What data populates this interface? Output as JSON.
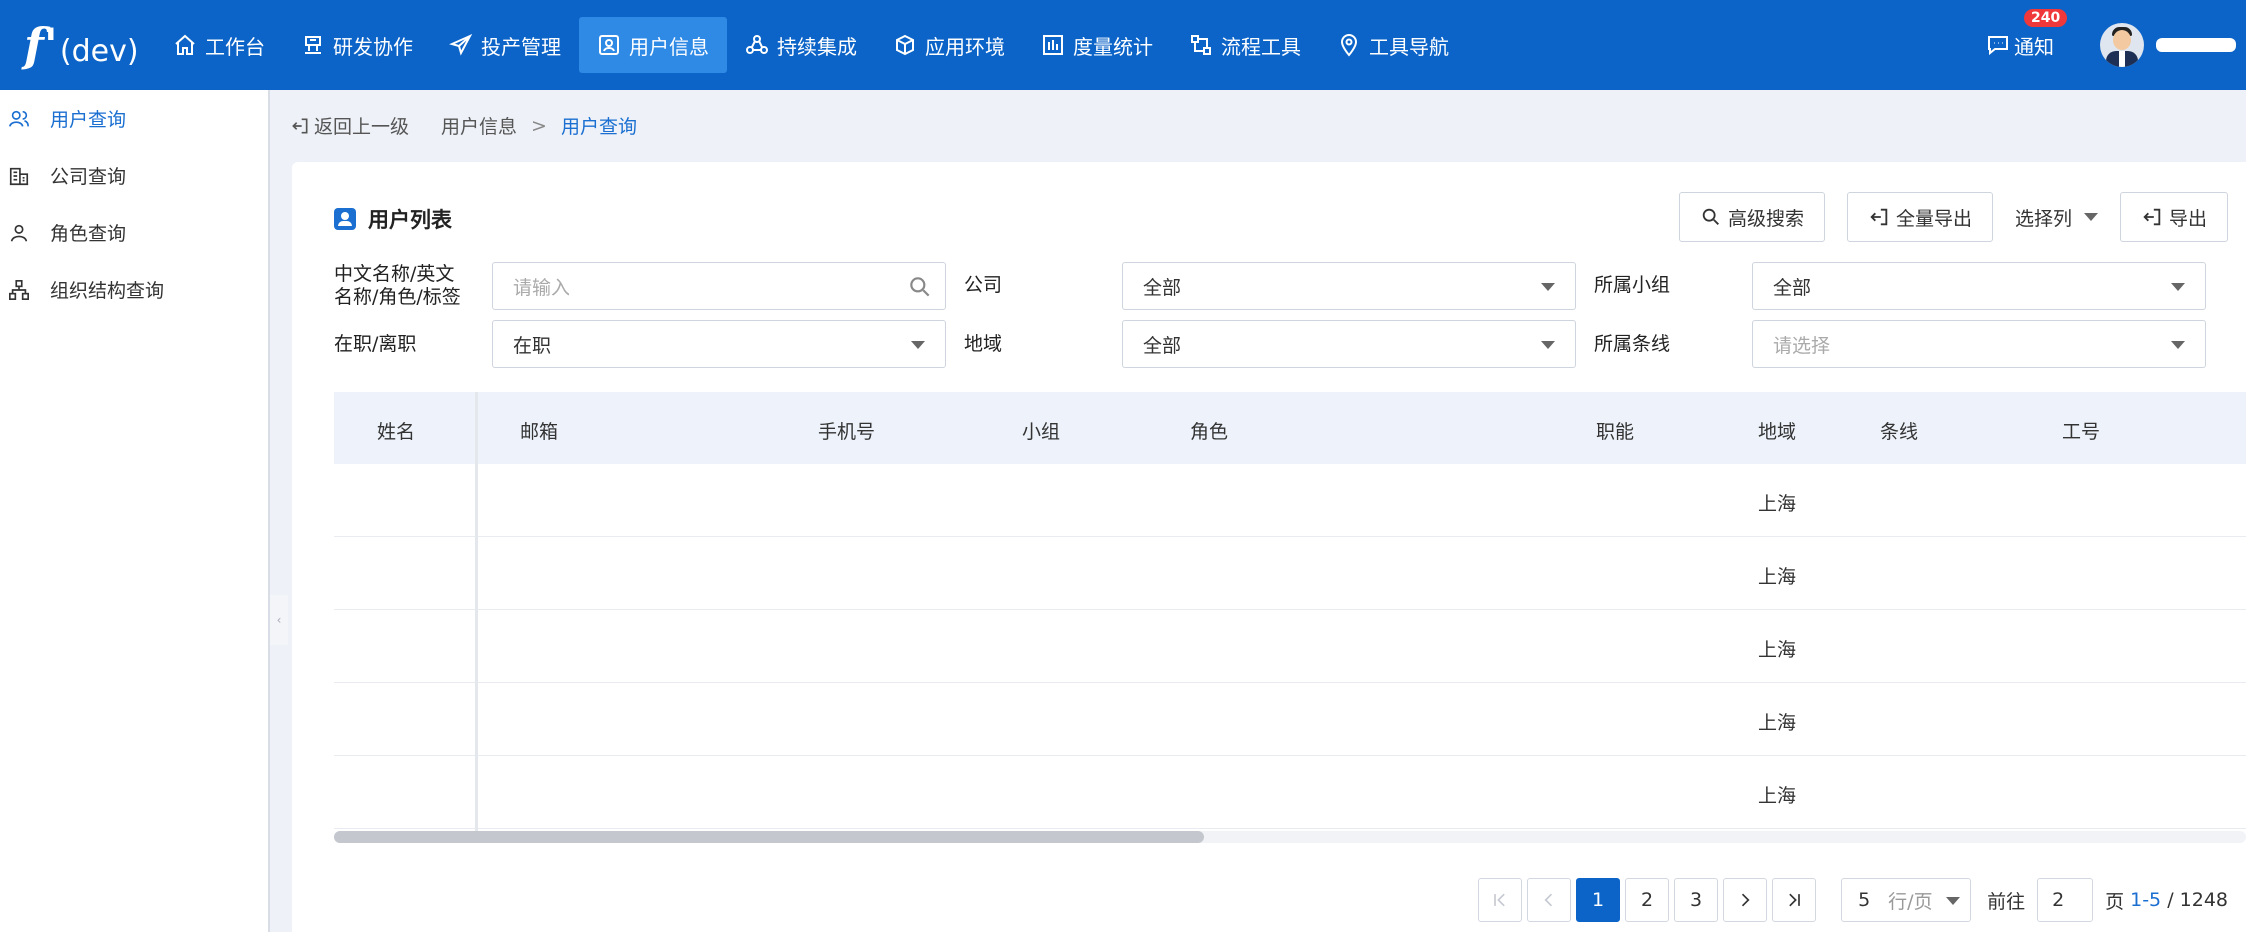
{
  "header": {
    "logo_main": "f'",
    "logo_sub": "(dev)",
    "nav": [
      {
        "label": "工作台",
        "icon": "home-icon"
      },
      {
        "label": "研发协作",
        "icon": "collab-icon"
      },
      {
        "label": "投产管理",
        "icon": "send-icon"
      },
      {
        "label": "用户信息",
        "icon": "user-card-icon",
        "active": true
      },
      {
        "label": "持续集成",
        "icon": "integration-icon"
      },
      {
        "label": "应用环境",
        "icon": "cube-icon"
      },
      {
        "label": "度量统计",
        "icon": "chart-icon"
      },
      {
        "label": "流程工具",
        "icon": "flow-icon"
      },
      {
        "label": "工具导航",
        "icon": "location-icon"
      }
    ],
    "notify_label": "通知",
    "notify_count": "240"
  },
  "sidebar": {
    "items": [
      {
        "label": "用户查询",
        "icon": "users-icon",
        "active": true
      },
      {
        "label": "公司查询",
        "icon": "building-icon"
      },
      {
        "label": "角色查询",
        "icon": "person-icon"
      },
      {
        "label": "组织结构查询",
        "icon": "org-tree-icon"
      }
    ]
  },
  "breadcrumb": {
    "back": "返回上一级",
    "parent": "用户信息",
    "separator": ">",
    "current": "用户查询"
  },
  "card": {
    "title": "用户列表",
    "actions": {
      "advanced_search": "高级搜索",
      "export_all": "全量导出",
      "select_columns": "选择列",
      "export": "导出"
    },
    "filters": {
      "name_label_line1": "中文名称/英文",
      "name_label_line2": "名称/角色/标签",
      "name_placeholder": "请输入",
      "company_label": "公司",
      "company_value": "全部",
      "group_label": "所属小组",
      "group_value": "全部",
      "status_label": "在职/离职",
      "status_value": "在职",
      "region_label": "地域",
      "region_value": "全部",
      "line_label": "所属条线",
      "line_placeholder": "请选择"
    },
    "table": {
      "columns": [
        "姓名",
        "邮箱",
        "手机号",
        "小组",
        "角色",
        "职能",
        "地域",
        "条线",
        "工号"
      ],
      "rows": [
        {
          "region": "上海"
        },
        {
          "region": "上海"
        },
        {
          "region": "上海"
        },
        {
          "region": "上海"
        },
        {
          "region": "上海"
        }
      ]
    },
    "pagination": {
      "pages": [
        "1",
        "2",
        "3"
      ],
      "current_page": "1",
      "page_size": "5",
      "page_size_unit": "行/页",
      "goto_label": "前往",
      "goto_value": "2",
      "page_unit": "页",
      "range": "1-5",
      "total_sep": " / ",
      "total": "1248"
    }
  },
  "colors": {
    "brand": "#0c64c8",
    "nav_active": "#2f8ae6",
    "link": "#1a6fd1",
    "badge": "#f0373a"
  }
}
